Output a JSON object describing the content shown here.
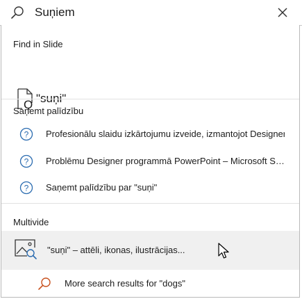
{
  "search": {
    "query": "Suņiem",
    "icon": "search-icon",
    "clear_icon": "close-icon"
  },
  "find_in_slide": {
    "title": "Find in Slide",
    "result_text": "\"suņi\"",
    "icon": "find-in-document-icon"
  },
  "help": {
    "title": "Saņemt palīdzību",
    "items": [
      {
        "label": "Profesionālu slaidu izkārtojumu izveide, izmantojot Designer - Micro",
        "icon": "help-circle-icon"
      },
      {
        "label": "Problēmu Designer programmā PowerPoint – Microsoft Support",
        "icon": "help-circle-icon"
      },
      {
        "label": "Saņemt palīdzību par \"suņi\"",
        "icon": "help-circle-icon"
      }
    ]
  },
  "multimedia": {
    "title": "Multivide",
    "item_label": "\"suņi\" – attēli, ikonas, ilustrācijas...",
    "icon": "image-search-icon"
  },
  "more_results": {
    "label": "More search results for \"dogs\"",
    "icon": "search-icon"
  },
  "colors": {
    "help_icon": "#2b6cb0",
    "more_icon": "#c8511e",
    "hover_background": "#f0f0f0"
  }
}
